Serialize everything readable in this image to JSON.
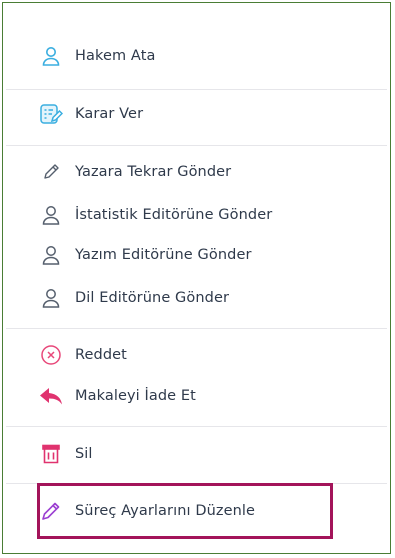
{
  "menu": {
    "items": [
      {
        "id": "hakem-ata",
        "label": "Hakem Ata",
        "icon": "user-icon",
        "color": "#3aaee0"
      },
      {
        "id": "karar-ver",
        "label": "Karar Ver",
        "icon": "form-edit-icon",
        "color": "#3aaee0"
      },
      {
        "id": "yazara-tekrar-gonder",
        "label": "Yazara Tekrar Gönder",
        "icon": "pencil-icon",
        "color": "#555f6d"
      },
      {
        "id": "istatistik-editorune-gonder",
        "label": "İstatistik Editörüne Gönder",
        "icon": "user-icon",
        "color": "#555f6d"
      },
      {
        "id": "yazim-editorune-gonder",
        "label": "Yazım Editörüne Gönder",
        "icon": "user-icon",
        "color": "#555f6d"
      },
      {
        "id": "dil-editorune-gonder",
        "label": "Dil Editörüne Gönder",
        "icon": "user-icon",
        "color": "#555f6d"
      },
      {
        "id": "reddet",
        "label": "Reddet",
        "icon": "close-circle-icon",
        "color": "#e8487a"
      },
      {
        "id": "makaleyi-iade-et",
        "label": "Makaleyi İade Et",
        "icon": "reply-arrow-icon",
        "color": "#e0336f"
      },
      {
        "id": "sil",
        "label": "Sil",
        "icon": "trash-icon",
        "color": "#e0336f"
      },
      {
        "id": "surec-ayarlarini-duzenle",
        "label": "Süreç Ayarlarını Düzenle",
        "icon": "pencil-icon",
        "color": "#9b3fd1"
      }
    ]
  },
  "colors": {
    "border": "#4a7d35",
    "highlight": "#a3145a",
    "divider": "#e6e6ea",
    "text": "#2f3a4b"
  }
}
